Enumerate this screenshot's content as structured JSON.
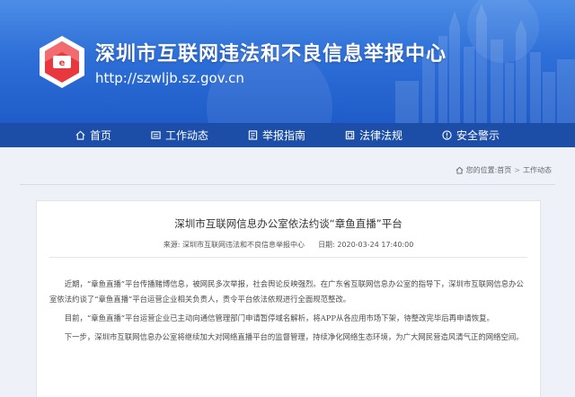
{
  "site": {
    "title": "深圳市互联网违法和不良信息举报中心",
    "url": "http://szwljb.sz.gov.cn",
    "brand_color": "#2e6fd8",
    "nav_color": "#1c4ea8"
  },
  "nav": [
    {
      "label": "首页",
      "icon": "home-icon"
    },
    {
      "label": "工作动态",
      "icon": "news-icon"
    },
    {
      "label": "举报指南",
      "icon": "guide-icon"
    },
    {
      "label": "法律法规",
      "icon": "law-icon"
    },
    {
      "label": "安全警示",
      "icon": "warning-icon"
    }
  ],
  "breadcrumb": {
    "prefix": "您的位置:",
    "home": "首页",
    "separator": ">",
    "current": "工作动态"
  },
  "article": {
    "title": "深圳市互联网信息办公室依法约谈“章鱼直播”平台",
    "source_label": "来源:",
    "source": "深圳市互联网违法和不良信息举报中心",
    "date_label": "日期:",
    "date": "2020-03-24 17:40:00",
    "paragraphs": [
      "近期，“章鱼直播”平台传播赌博信息，被网民多次举报，社会舆论反映强烈。在广东省互联网信息办公室的指导下，深圳市互联网信息办公室依法约谈了“章鱼直播”平台运营企业相关负责人，责令平台依法依规进行全面规范整改。",
      "目前，“章鱼直播”平台运营企业已主动向通信管理部门申请暂停域名解析，将APP从各应用市场下架，待整改完毕后再申请恢复。",
      "下一步，深圳市互联网信息办公室将继续加大对网络直播平台的监督管理，持续净化网络生态环境，为广大网民营造风清气正的网络空间。"
    ]
  }
}
